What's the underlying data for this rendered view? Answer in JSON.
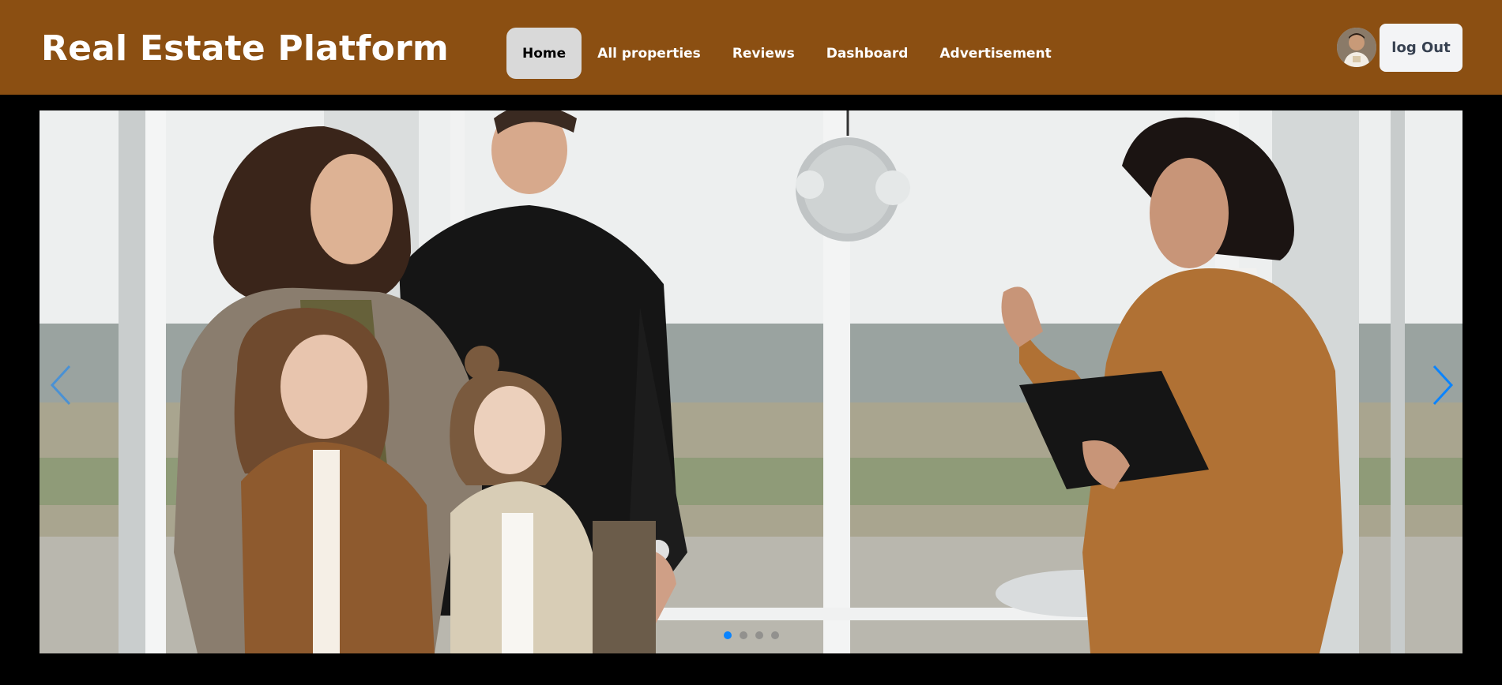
{
  "brand": {
    "title": "Real Estate Platform"
  },
  "nav": {
    "items": [
      {
        "label": "Home",
        "active": true
      },
      {
        "label": "All properties",
        "active": false
      },
      {
        "label": "Reviews",
        "active": false
      },
      {
        "label": "Dashboard",
        "active": false
      },
      {
        "label": "Advertisement",
        "active": false
      }
    ]
  },
  "user": {
    "avatar": "user-avatar",
    "logout_label": "log Out"
  },
  "carousel": {
    "slide_count": 4,
    "active_index": 0,
    "prev_icon": "chevron-left-icon",
    "next_icon": "chevron-right-icon"
  },
  "colors": {
    "navbar": "#8b4f12",
    "accent": "#0a84ff",
    "active_tab": "#d9d9d9"
  }
}
